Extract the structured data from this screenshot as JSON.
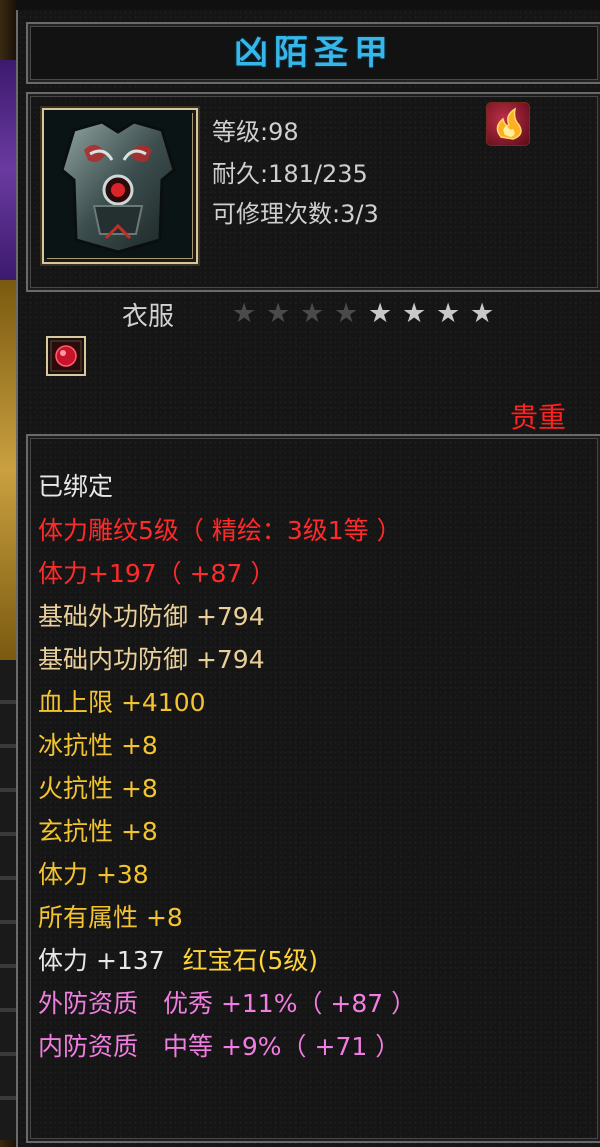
{
  "item": {
    "name": "凶陌圣甲",
    "level_label": "等级:98",
    "durability_label": "耐久:181/235",
    "repair_label": "可修理次数:3/3",
    "type_label": "衣服",
    "rarity_label": "贵重",
    "stars_filled": 4,
    "stars_total": 8
  },
  "icons": {
    "item_icon": "armor-icon",
    "element_icon": "fire-element-icon",
    "gem_icon": "ruby-gem-icon",
    "star_icon": "star-icon"
  },
  "attributes": {
    "bound": "已绑定",
    "engrave": "体力雕纹5级（ 精绘：3级1等 ）",
    "stamina_enhanced": "体力+197（ +87 ）",
    "base_ext_def": "基础外功防御 +794",
    "base_int_def": "基础内功防御 +794",
    "hp_max": "血上限 +4100",
    "ice_res": "冰抗性 +8",
    "fire_res": "火抗性 +8",
    "mystic_res": "玄抗性 +8",
    "stamina": "体力 +38",
    "all_attr": "所有属性 +8",
    "gem_stat": "体力 +137",
    "gem_name": "红宝石(5级)",
    "ext_quality": "外防资质　优秀 +11%（ +87 ）",
    "int_quality": "内防资质　中等 +9%（ +71 ）"
  },
  "colors": {
    "title": "#35b7ea",
    "red": "#ff2a2a",
    "tan": "#e9cf9a",
    "yellow": "#f3c430",
    "pink": "#f07ee0",
    "star_bright": "#c8c8c8",
    "star_dim": "#4a4a4a"
  }
}
